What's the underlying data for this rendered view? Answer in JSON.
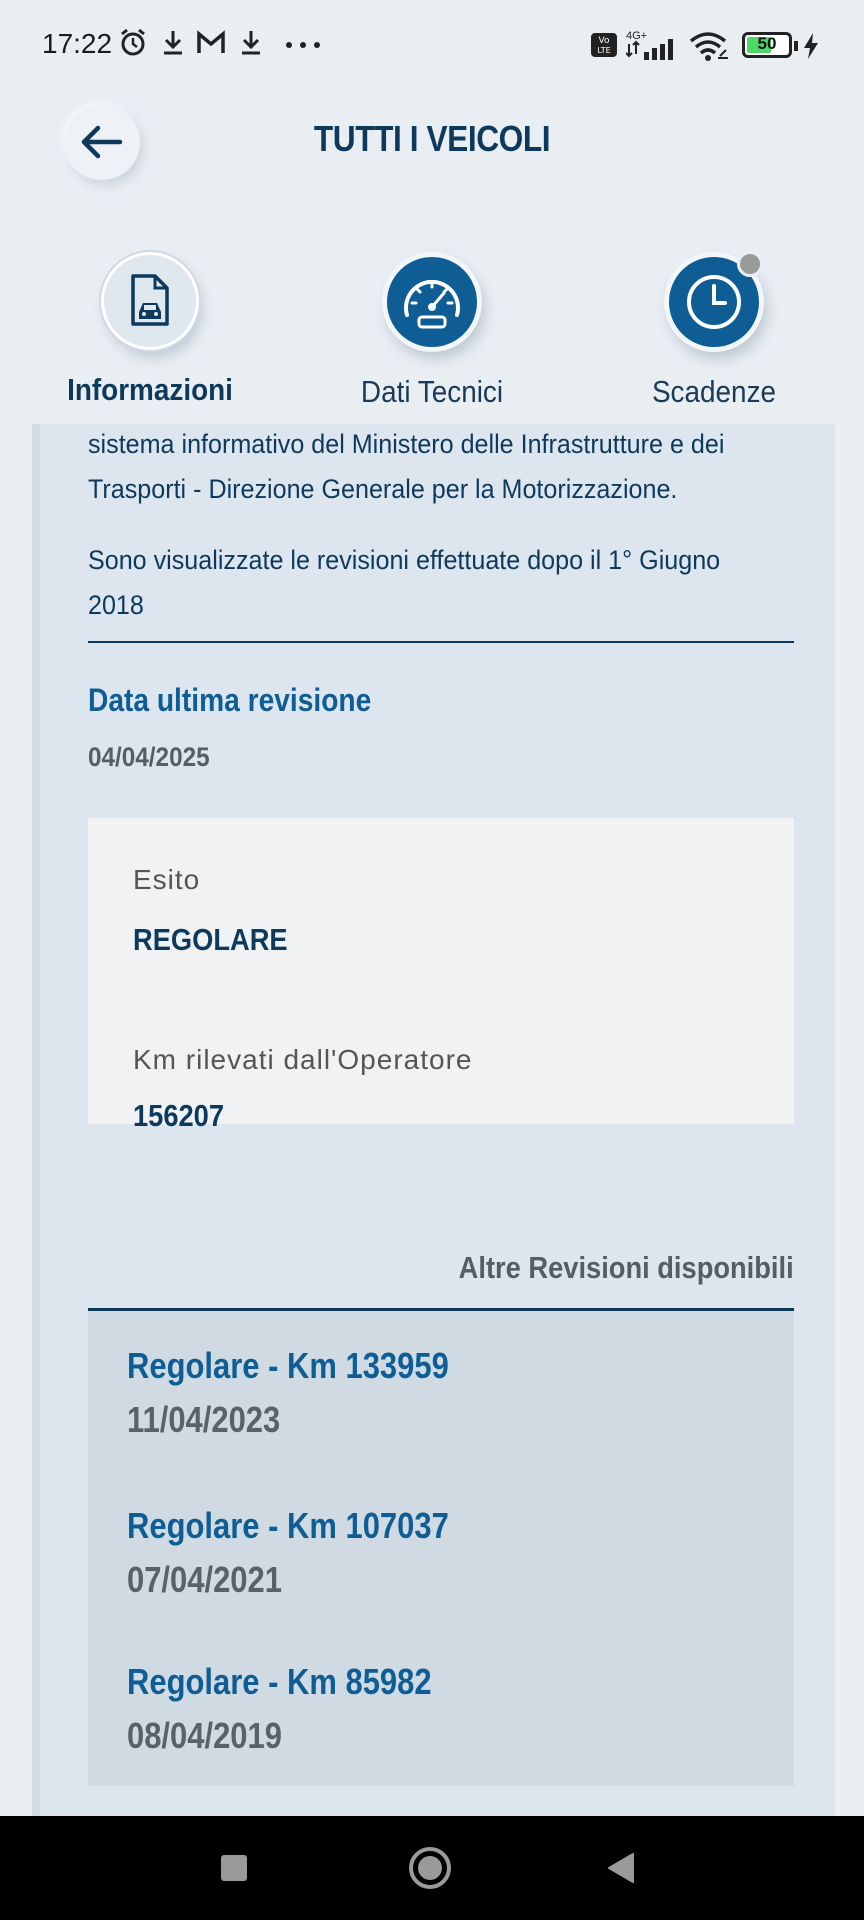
{
  "status_bar": {
    "time": "17:22",
    "battery": "50",
    "network": "4G+",
    "icons": [
      "alarm-icon",
      "download-icon",
      "gmail-icon",
      "download-icon",
      "more-dots-icon",
      "volte-icon",
      "signal-icon",
      "wifi-icon",
      "battery-icon",
      "charging-icon"
    ]
  },
  "header": {
    "title": "TUTTI I VEICOLI",
    "back_icon": "arrow-left-icon"
  },
  "tabs": [
    {
      "label": "Informazioni",
      "icon": "document-car-icon",
      "active": true
    },
    {
      "label": "Dati Tecnici",
      "icon": "speedometer-icon",
      "active": false
    },
    {
      "label": "Scadenze",
      "icon": "clock-icon",
      "active": false
    }
  ],
  "content": {
    "intro_line1": "sistema informativo del Ministero delle Infrastrutture e dei",
    "intro_line2": "Trasporti - Direzione Generale per la Motorizzazione.",
    "note_line1": "Sono visualizzate le revisioni effettuate dopo il 1° Giugno",
    "note_line2": "2018",
    "last_revision_title": "Data ultima revisione",
    "last_revision_date": "04/04/2025",
    "result": {
      "esito_label": "Esito",
      "esito_value": "REGOLARE",
      "km_label": "Km rilevati dall'Operatore",
      "km_value": "156207"
    },
    "other_revisions_label": "Altre Revisioni disponibili",
    "other_revisions": [
      {
        "title": "Regolare - Km 133959",
        "date": "11/04/2023"
      },
      {
        "title": "Regolare - Km 107037",
        "date": "07/04/2021"
      },
      {
        "title": "Regolare - Km 85982",
        "date": "08/04/2019"
      }
    ]
  },
  "colors": {
    "primary": "#0f5d95",
    "dark_text": "#0d3a5c",
    "background": "#e9eef3",
    "card": "#dde6ef"
  }
}
